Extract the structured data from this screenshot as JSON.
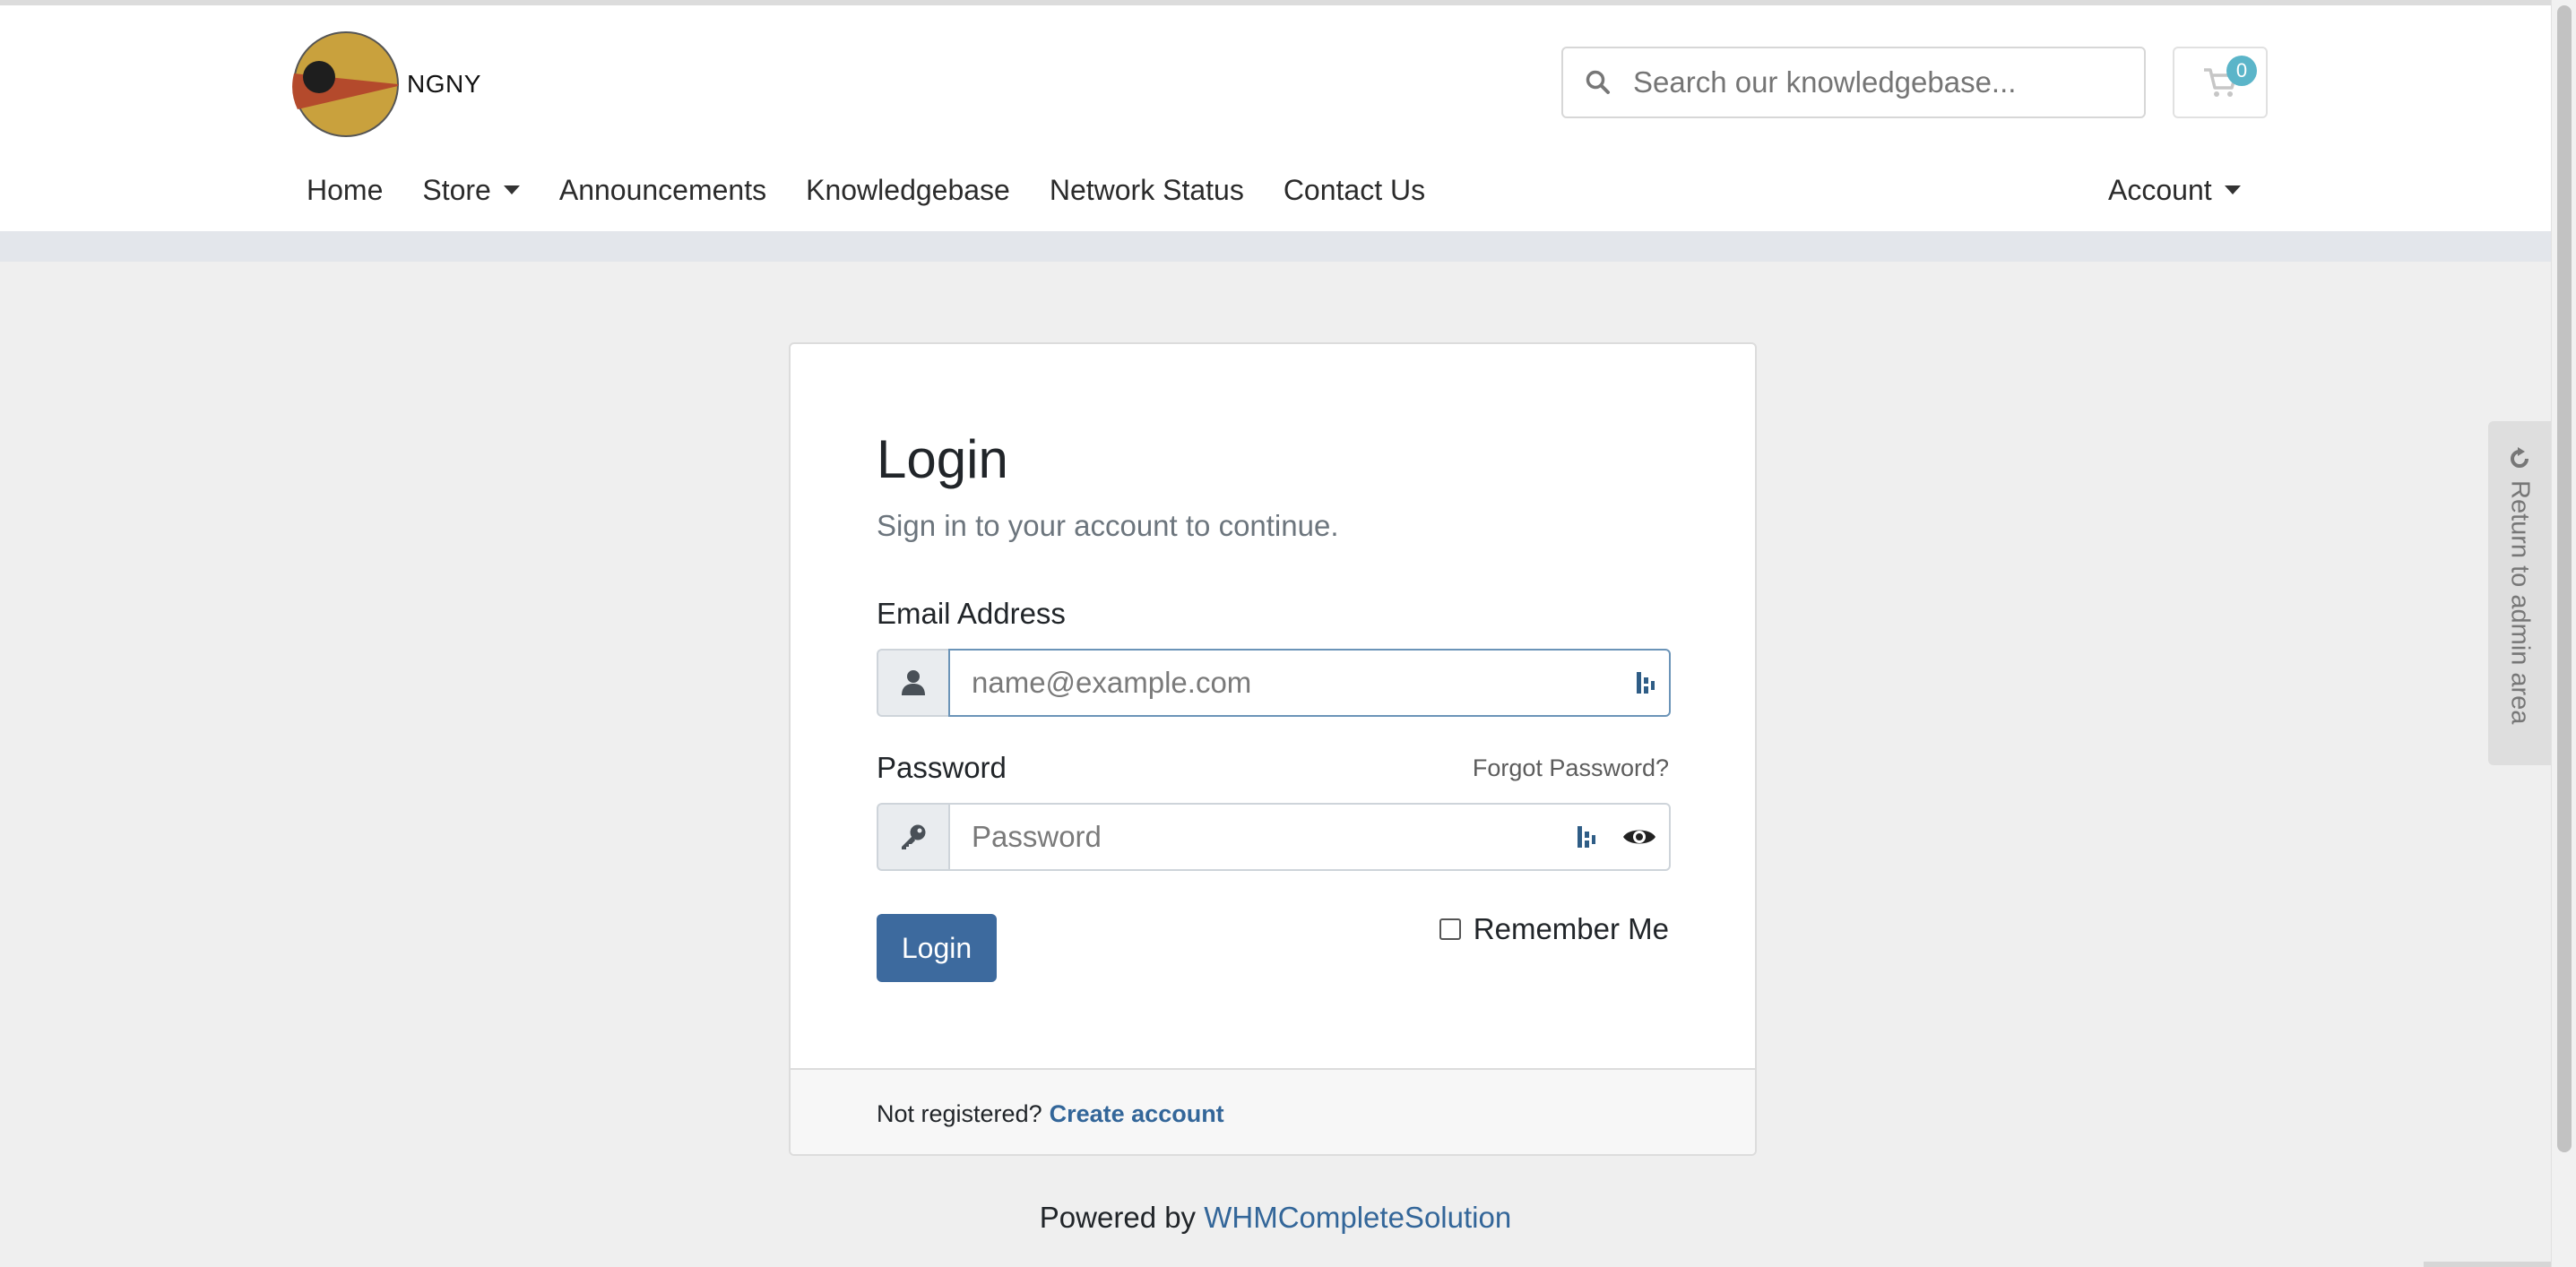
{
  "brand": {
    "name": "NGNY"
  },
  "search": {
    "placeholder": "Search our knowledgebase..."
  },
  "cart": {
    "count": "0"
  },
  "nav": {
    "items": [
      {
        "label": "Home",
        "dropdown": false
      },
      {
        "label": "Store",
        "dropdown": true
      },
      {
        "label": "Announcements",
        "dropdown": false
      },
      {
        "label": "Knowledgebase",
        "dropdown": false
      },
      {
        "label": "Network Status",
        "dropdown": false
      },
      {
        "label": "Contact Us",
        "dropdown": false
      }
    ],
    "account_label": "Account"
  },
  "login": {
    "title": "Login",
    "subtitle": "Sign in to your account to continue.",
    "email_label": "Email Address",
    "email_placeholder": "name@example.com",
    "email_value": "",
    "password_label": "Password",
    "password_placeholder": "Password",
    "password_value": "",
    "forgot_label": "Forgot Password?",
    "submit_label": "Login",
    "remember_label": "Remember Me",
    "remember_checked": false,
    "not_registered": "Not registered?",
    "create_account": "Create account"
  },
  "footer": {
    "powered_by": "Powered by",
    "powered_link": "WHMCompleteSolution"
  },
  "admin_tab": {
    "label": "Return to admin area"
  },
  "colors": {
    "accent": "#3d6a9e",
    "link": "#336699",
    "badge": "#5bb5c9",
    "page_bg": "#efefef"
  }
}
